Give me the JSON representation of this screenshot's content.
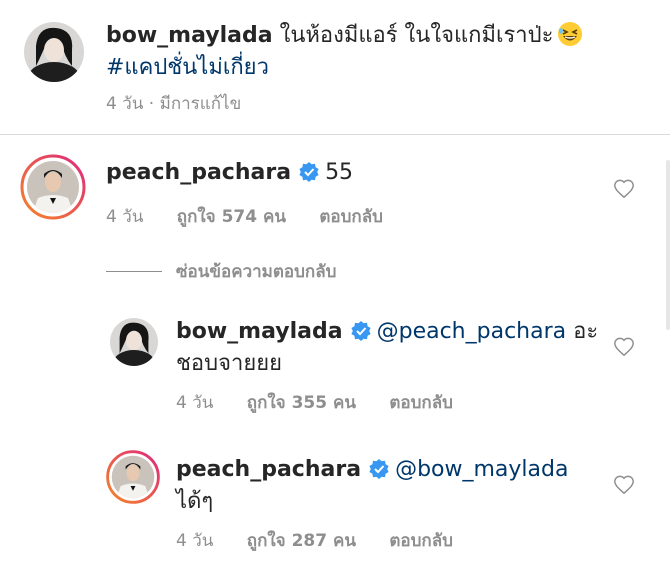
{
  "caption": {
    "username": "bow_maylada",
    "text": "ในห้องมีแอร์ ในใจแกมีเราป่ะ",
    "hashtag": "#แคปชั่นไม่เกี่ยว",
    "age": "4 วัน",
    "separator": "·",
    "edited": "มีการแก้ไข"
  },
  "comments": [
    {
      "username": "peach_pachara",
      "text": "55",
      "age": "4 วัน",
      "likes": "ถูกใจ 574 คน",
      "reply": "ตอบกลับ"
    }
  ],
  "toggle_replies": "ซ่อนข้อความตอบกลับ",
  "replies": [
    {
      "username": "bow_maylada",
      "mention": "@peach_pachara",
      "text": "อะชอบจายยย",
      "age": "4 วัน",
      "likes": "ถูกใจ 355 คน",
      "reply": "ตอบกลับ"
    },
    {
      "username": "peach_pachara",
      "mention": "@bow_maylada",
      "text": "ได้ๆ",
      "age": "4 วัน",
      "likes": "ถูกใจ 287 คน",
      "reply": "ตอบกลับ"
    }
  ],
  "colors": {
    "verified": "#3897f0",
    "story_ring_start": "#f58529",
    "story_ring_end": "#dd2a7b",
    "link": "#00376b",
    "muted": "#8e8e8e"
  }
}
